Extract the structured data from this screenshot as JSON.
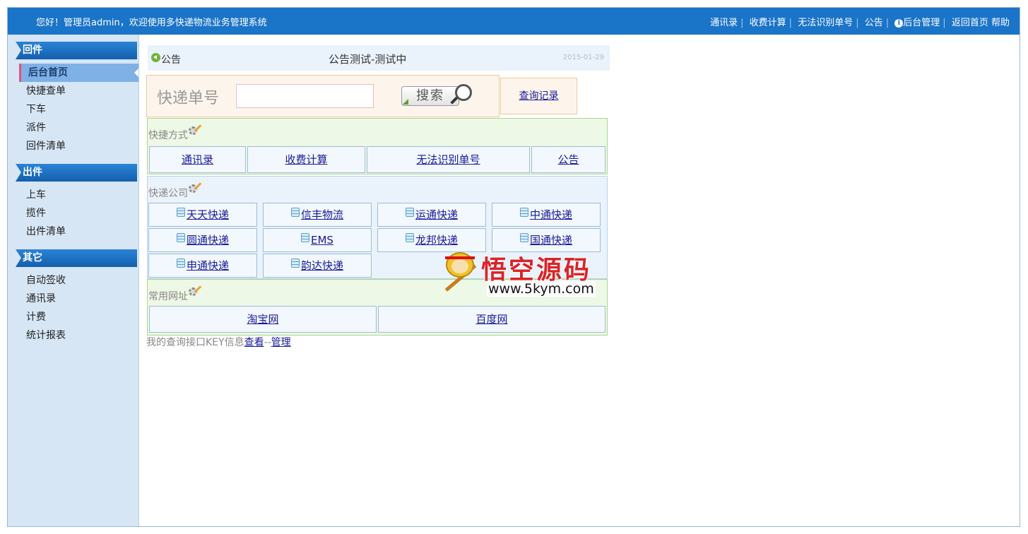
{
  "topbar": {
    "greeting": "您好！管理员admin，欢迎使用多快递物流业务管理系统",
    "links": [
      "通讯录",
      "收费计算",
      "无法识别单号",
      "公告"
    ],
    "admin_link": "后台管理",
    "home_link": "返回首页",
    "help_link": "帮助"
  },
  "sidebar": {
    "sections": [
      {
        "title": "回件",
        "items": [
          "后台首页",
          "快捷查单",
          "下车",
          "派件",
          "回件清单"
        ]
      },
      {
        "title": "出件",
        "items": [
          "上车",
          "揽件",
          "出件清单"
        ]
      },
      {
        "title": "其它",
        "items": [
          "自动签收",
          "通讯录",
          "计费",
          "统计报表"
        ]
      }
    ],
    "active_item": "后台首页"
  },
  "notice": {
    "label": "公告",
    "title": "公告测试-测试中",
    "date": "2015-01-29"
  },
  "search": {
    "label": "快递单号",
    "value": "",
    "placeholder": "",
    "button_label": "搜索",
    "query_link": "查询记录"
  },
  "quick": {
    "title": "快捷方式",
    "links": [
      "通讯录",
      "收费计算",
      "无法识别单号",
      "公告"
    ]
  },
  "companies": {
    "title": "快递公司",
    "items": [
      "天天快递",
      "信丰物流",
      "运通快递",
      "中通快递",
      "圆通快递",
      "EMS",
      "龙邦快递",
      "国通快递",
      "申通快递",
      "韵达快递"
    ]
  },
  "urls": {
    "title": "常用网址",
    "links": [
      "淘宝网",
      "百度网"
    ]
  },
  "footer": {
    "text": "我的查询接口KEY信息",
    "view_link": "查看",
    "separator": "--",
    "manage_link": "管理"
  },
  "watermark": {
    "title": "悟空源码",
    "url": "www.5kym.com"
  },
  "colors": {
    "topbar": "#1a74c8",
    "sidebar": "#d6e6f5",
    "accent": "#e8507a"
  }
}
